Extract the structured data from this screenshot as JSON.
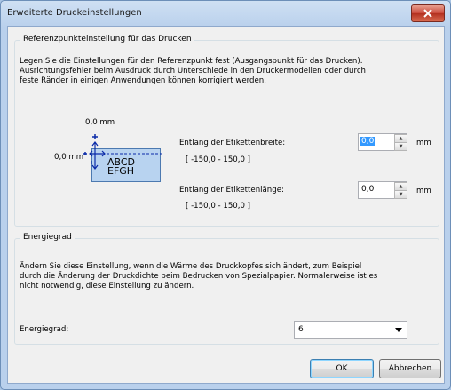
{
  "window": {
    "title": "Erweiterte Druckeinstellungen",
    "close_label": "✕"
  },
  "reference": {
    "group_title": "Referenzpunkteinstellung für das Drucken",
    "description": [
      "Legen Sie die Einstellungen für den Referenzpunkt fest (Ausgangspunkt für das Drucken).",
      "Ausrichtungsfehler beim Ausdruck durch Unterschiede in den Druckermodellen oder durch",
      "feste Ränder in einigen Anwendungen können korrigiert werden."
    ],
    "preview": {
      "top_offset": "0,0 mm",
      "left_offset": "0,0 mm",
      "sample_line1": "ABCD",
      "sample_line2": "EFGH"
    },
    "width": {
      "label": "Entlang der Etikettenbreite:",
      "range": "[ -150,0 - 150,0 ]",
      "value": "0,0",
      "unit": "mm"
    },
    "length": {
      "label": "Entlang der Etikettenlänge:",
      "range": "[ -150,0 - 150,0 ]",
      "value": "0,0",
      "unit": "mm"
    }
  },
  "energy": {
    "group_title": "Energiegrad",
    "description": [
      "Ändern Sie diese Einstellung, wenn die Wärme des Druckkopfes sich ändert, zum Beispiel",
      "durch die Änderung der Druckdichte beim Bedrucken von Spezialpapier. Normalerweise ist es",
      "nicht notwendig, diese Einstellung zu ändern."
    ],
    "label": "Energiegrad:",
    "value": "6"
  },
  "buttons": {
    "ok": "OK",
    "cancel": "Abbrechen"
  }
}
